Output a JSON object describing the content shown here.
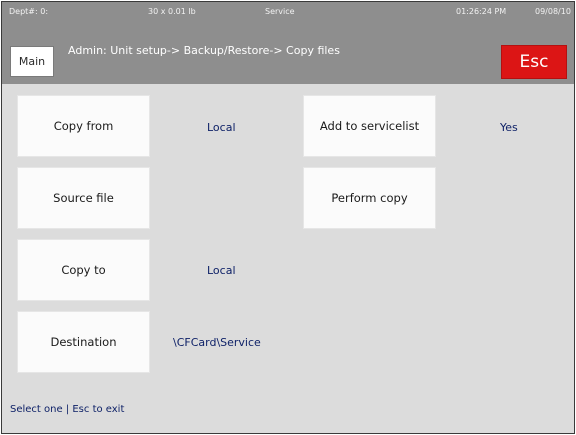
{
  "status": {
    "dept": "Dept#: 0:",
    "weight": "30 x 0.01 lb",
    "mode": "Service",
    "time": "01:26:24 PM",
    "date": "09/08/10"
  },
  "header": {
    "main_label": "Main",
    "title": "Admin: Unit setup-> Backup/Restore-> Copy files",
    "esc_label": "Esc"
  },
  "options": {
    "copy_from": {
      "label": "Copy from",
      "value": "Local"
    },
    "source_file": {
      "label": "Source file",
      "value": ""
    },
    "copy_to": {
      "label": "Copy to",
      "value": "Local"
    },
    "destination": {
      "label": "Destination",
      "value": "\\CFCard\\Service"
    },
    "add_to_servicelist": {
      "label": "Add to servicelist",
      "value": "Yes"
    },
    "perform_copy": {
      "label": "Perform copy"
    }
  },
  "footer": {
    "hint": "Select one | Esc to exit"
  },
  "colors": {
    "header_bg": "#8e8e8e",
    "body_bg": "#dcdcdc",
    "esc_red": "#dc1515",
    "value_text": "#0c1f66"
  }
}
